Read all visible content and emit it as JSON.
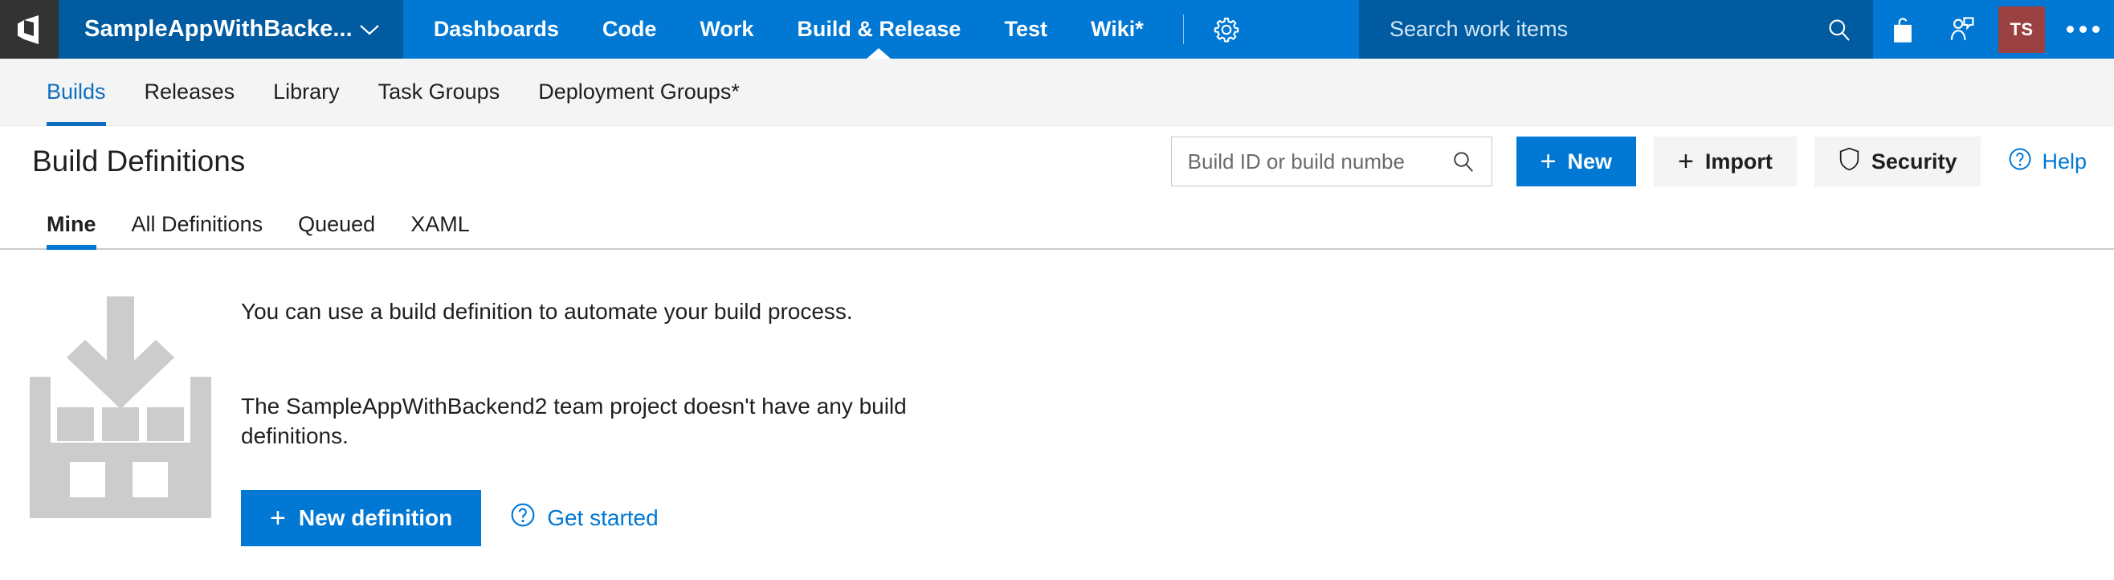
{
  "header": {
    "logo_icon": "vsts-logo-icon",
    "project": {
      "name": "SampleAppWithBacke...",
      "caret_icon": "chevron-down-icon"
    },
    "nav_items": [
      {
        "label": "Dashboards",
        "active": false
      },
      {
        "label": "Code",
        "active": false
      },
      {
        "label": "Work",
        "active": false
      },
      {
        "label": "Build & Release",
        "active": true
      },
      {
        "label": "Test",
        "active": false
      },
      {
        "label": "Wiki*",
        "active": false
      }
    ],
    "settings_icon": "gear-icon",
    "search": {
      "placeholder": "Search work items",
      "icon": "search-icon"
    },
    "actions": [
      {
        "name": "marketplace-icon",
        "label": "Marketplace"
      },
      {
        "name": "user-feedback-icon",
        "label": "Feedback"
      }
    ],
    "avatar": {
      "initials": "TS",
      "color": "#9c4141"
    },
    "more_icon": "more-horizontal-icon",
    "colors": {
      "bar": "#0078d4",
      "project_chip": "#005ba1",
      "logo_tile": "#333333"
    }
  },
  "hubnav": {
    "items": [
      {
        "label": "Builds",
        "active": true
      },
      {
        "label": "Releases",
        "active": false
      },
      {
        "label": "Library",
        "active": false
      },
      {
        "label": "Task Groups",
        "active": false
      },
      {
        "label": "Deployment Groups*",
        "active": false
      }
    ],
    "accent": "#106ebe"
  },
  "page": {
    "title": "Build Definitions"
  },
  "toolbar": {
    "search": {
      "placeholder": "Build ID or build numbe",
      "value": "",
      "icon": "search-icon"
    },
    "new_label": "New",
    "import_label": "Import",
    "security_label": "Security",
    "security_icon": "shield-icon",
    "help_label": "Help",
    "help_icon": "question-circle-icon",
    "plus_icon": "plus-icon",
    "primary_color": "#0078d4"
  },
  "pivots": {
    "items": [
      {
        "label": "Mine",
        "active": true
      },
      {
        "label": "All Definitions",
        "active": false
      },
      {
        "label": "Queued",
        "active": false
      },
      {
        "label": "XAML",
        "active": false
      }
    ],
    "accent": "#0078d4"
  },
  "empty_state": {
    "illustration_icon": "build-bin-download-icon",
    "illustration_color": "#cccccc",
    "line1": "You can use a build definition to automate your build process.",
    "line2": "The SampleAppWithBackend2 team project doesn't have any build definitions.",
    "new_definition_label": "New definition",
    "get_started_label": "Get started",
    "get_started_icon": "question-circle-icon",
    "plus_icon": "plus-icon"
  }
}
